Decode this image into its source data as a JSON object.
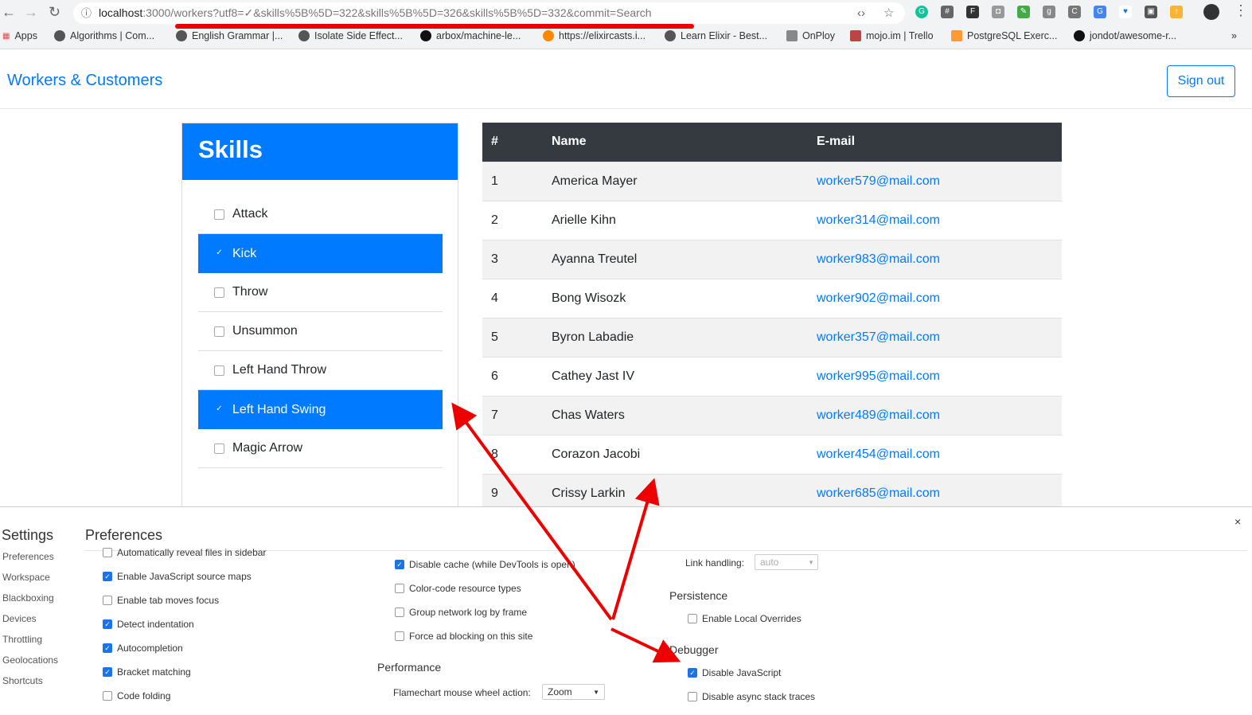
{
  "browser": {
    "url_host": "localhost",
    "url_rest": ":3000/workers?utf8=✓&skills%5B%5D=322&skills%5B%5D=326&skills%5B%5D=332&commit=Search",
    "bookmarks": [
      "Apps",
      "Algorithms | Com...",
      "English Grammar |...",
      "Isolate Side Effect...",
      "arbox/machine-le...",
      "https://elixircasts.i...",
      "Learn Elixir - Best...",
      "OnPloy",
      "mojo.im | Trello",
      "PostgreSQL Exerc...",
      "jondot/awesome-r..."
    ],
    "more": "»"
  },
  "app": {
    "brand": "Workers & Customers",
    "sign_out": "Sign out"
  },
  "skills": {
    "title": "Skills",
    "items": [
      {
        "label": "Attack",
        "checked": false
      },
      {
        "label": "Kick",
        "checked": true
      },
      {
        "label": "Throw",
        "checked": false
      },
      {
        "label": "Unsummon",
        "checked": false
      },
      {
        "label": "Left Hand Throw",
        "checked": false
      },
      {
        "label": "Left Hand Swing",
        "checked": true
      },
      {
        "label": "Magic Arrow",
        "checked": false
      }
    ]
  },
  "table": {
    "headers": [
      "#",
      "Name",
      "E-mail"
    ],
    "rows": [
      [
        "1",
        "America Mayer",
        "worker579@mail.com"
      ],
      [
        "2",
        "Arielle Kihn",
        "worker314@mail.com"
      ],
      [
        "3",
        "Ayanna Treutel",
        "worker983@mail.com"
      ],
      [
        "4",
        "Bong Wisozk",
        "worker902@mail.com"
      ],
      [
        "5",
        "Byron Labadie",
        "worker357@mail.com"
      ],
      [
        "6",
        "Cathey Jast IV",
        "worker995@mail.com"
      ],
      [
        "7",
        "Chas Waters",
        "worker489@mail.com"
      ],
      [
        "8",
        "Corazon Jacobi",
        "worker454@mail.com"
      ],
      [
        "9",
        "Crissy Larkin",
        "worker685@mail.com"
      ]
    ]
  },
  "devtools": {
    "title": "Settings",
    "section": "Preferences",
    "close": "×",
    "sidebar": [
      "Preferences",
      "Workspace",
      "Blackboxing",
      "Devices",
      "Throttling",
      "Geolocations",
      "Shortcuts"
    ],
    "col1": [
      {
        "label": "Automatically reveal files in sidebar",
        "checked": false
      },
      {
        "label": "Enable JavaScript source maps",
        "checked": true
      },
      {
        "label": "Enable tab moves focus",
        "checked": false
      },
      {
        "label": "Detect indentation",
        "checked": true
      },
      {
        "label": "Autocompletion",
        "checked": true
      },
      {
        "label": "Bracket matching",
        "checked": true
      },
      {
        "label": "Code folding",
        "checked": false
      }
    ],
    "col2": [
      {
        "label": "Disable cache (while DevTools is open)",
        "checked": true
      },
      {
        "label": "Color-code resource types",
        "checked": false
      },
      {
        "label": "Group network log by frame",
        "checked": false
      },
      {
        "label": "Force ad blocking on this site",
        "checked": false
      }
    ],
    "performance": {
      "heading": "Performance",
      "label": "Flamechart mouse wheel action:",
      "value": "Zoom"
    },
    "link_handling": {
      "label": "Link handling:",
      "value": "auto"
    },
    "persistence": {
      "heading": "Persistence",
      "options": [
        {
          "label": "Enable Local Overrides",
          "checked": false
        }
      ]
    },
    "debugger": {
      "heading": "Debugger",
      "options": [
        {
          "label": "Disable JavaScript",
          "checked": true
        },
        {
          "label": "Disable async stack traces",
          "checked": false
        }
      ]
    }
  },
  "colors": {
    "primary": "#007bff",
    "table_header": "#343a40",
    "annotation": "#e00000"
  }
}
